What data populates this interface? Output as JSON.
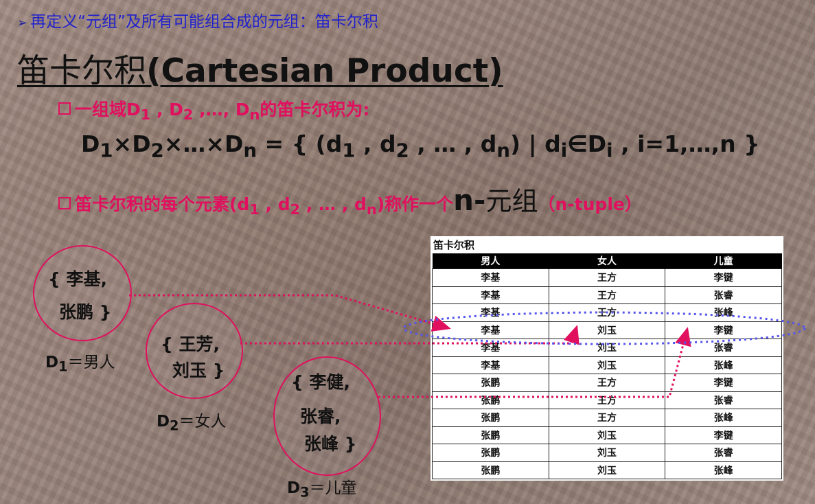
{
  "top": {
    "text": "再定义“元组”及所有可能组合成的元组：笛卡尔积"
  },
  "title": {
    "cn": "笛卡尔积",
    "en": "(Cartesian Product)"
  },
  "line3": {
    "a": "一组域D",
    "s1": "1",
    "b": " , D",
    "s2": "2",
    "c": " ,…, D",
    "sn": "n",
    "d": "的笛卡尔积为:"
  },
  "formula": {
    "d": "D",
    "sub1": "1",
    "x1": "×D",
    "sub2": "2",
    "x2": "×…×D",
    "subn": "n",
    "p1": " = { (d",
    "p2": " , d",
    "p3": " , … , d",
    "p4": ") | d",
    "subi": "i",
    "p5": "∈D",
    "p6": " , i=1,…,n }"
  },
  "line5": {
    "a": "笛卡尔积的每个元素(d",
    "s1": "1",
    "b": " , d",
    "s2": "2",
    "c": " , … , d",
    "sn": "n",
    "d": ")称作一个",
    "bold": "n-",
    "cn": "元组",
    "paren_open": "（",
    "paren": "n-tuple",
    "paren_close": "）"
  },
  "circles": {
    "d1_line1": "{ 李基,",
    "d1_line2": "张鹏 }",
    "d2_line1": "{ 王芳,",
    "d2_line2": "刘玉 }",
    "d3_line1": "{ 李健,",
    "d3_line2": "张睿,",
    "d3_line3": "张峰 }"
  },
  "labels": {
    "d1": {
      "d": "D",
      "sub": "1",
      "text": "＝男人"
    },
    "d2": {
      "d": "D",
      "sub": "2",
      "text": "＝女人"
    },
    "d3": {
      "d": "D",
      "sub": "3",
      "text": "＝儿童"
    }
  },
  "table": {
    "caption": "笛卡尔积",
    "headers": [
      "男人",
      "女人",
      "儿童"
    ],
    "rows": [
      [
        "李基",
        "王方",
        "李键"
      ],
      [
        "李基",
        "王方",
        "张睿"
      ],
      [
        "李基",
        "王方",
        "张峰"
      ],
      [
        "李基",
        "刘玉",
        "李键"
      ],
      [
        "李基",
        "刘玉",
        "张睿"
      ],
      [
        "李基",
        "刘玉",
        "张峰"
      ],
      [
        "张鹏",
        "王方",
        "李键"
      ],
      [
        "张鹏",
        "王方",
        "张睿"
      ],
      [
        "张鹏",
        "王方",
        "张峰"
      ],
      [
        "张鹏",
        "刘玉",
        "李键"
      ],
      [
        "张鹏",
        "刘玉",
        "张睿"
      ],
      [
        "张鹏",
        "刘玉",
        "张峰"
      ]
    ]
  },
  "colors": {
    "accent": "#e0105e",
    "heading_blue": "#2222cc",
    "highlight": "#5555ee"
  }
}
